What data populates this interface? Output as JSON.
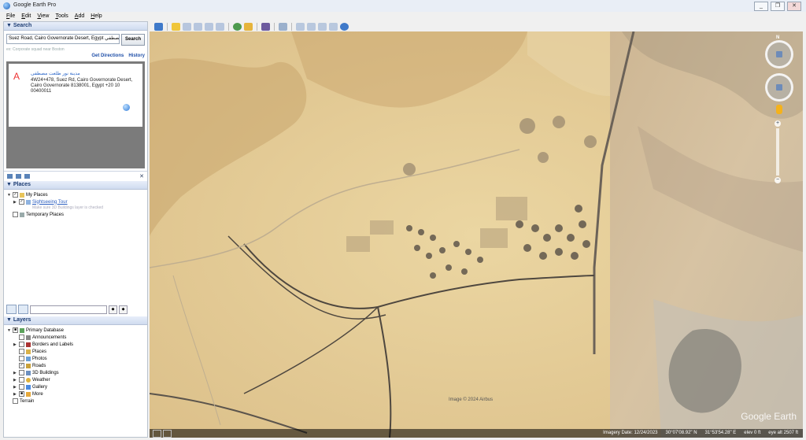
{
  "window": {
    "title": "Google Earth Pro",
    "controls": [
      "_",
      "❐",
      "✕"
    ]
  },
  "menu": [
    "File",
    "Edit",
    "View",
    "Tools",
    "Add",
    "Help"
  ],
  "search": {
    "header": "Search",
    "query": "Suez Road, Cairo Governorate Desert, Egypt ب مصطفي",
    "button": "Search",
    "hint": "ex: Corporate squad near Boston",
    "get_directions": "Get Directions",
    "history": "History",
    "result": {
      "marker": "A",
      "name": "مدينة نور طلعت مصطفى",
      "address": "4W24+478, Suez Rd, Cairo Governorate Desert, Cairo Governorate 8138001, Egypt +20 10 00400011"
    }
  },
  "places": {
    "header": "Places",
    "items": [
      {
        "label": "My Places",
        "checked": true
      },
      {
        "label": "Sightseeing Tour",
        "checked": true,
        "link": true
      },
      {
        "label": "Temporary Places",
        "checked": false
      }
    ],
    "note": "Make sure 3D Buildings layer is checked"
  },
  "layers": {
    "header": "Layers",
    "items": [
      {
        "label": "Primary Database",
        "checked": true
      },
      {
        "label": "Announcements",
        "checked": false
      },
      {
        "label": "Borders and Labels",
        "checked": false
      },
      {
        "label": "Places",
        "checked": false
      },
      {
        "label": "Photos",
        "checked": false
      },
      {
        "label": "Roads",
        "checked": true
      },
      {
        "label": "3D Buildings",
        "checked": false
      },
      {
        "label": "Weather",
        "checked": false
      },
      {
        "label": "Gallery",
        "checked": false
      },
      {
        "label": "More",
        "checked": false
      },
      {
        "label": "Terrain",
        "checked": false
      }
    ]
  },
  "map": {
    "attribution": "Image © 2024 Airbus",
    "watermark": "Google Earth",
    "status": {
      "imagery_date": "Imagery Date: 12/24/2023",
      "lat": "30°07'08.92\" N",
      "lon": "31°53'54.28\" E",
      "elev": "elev 0 ft",
      "eye_alt": "eye alt 2507 ft"
    }
  }
}
